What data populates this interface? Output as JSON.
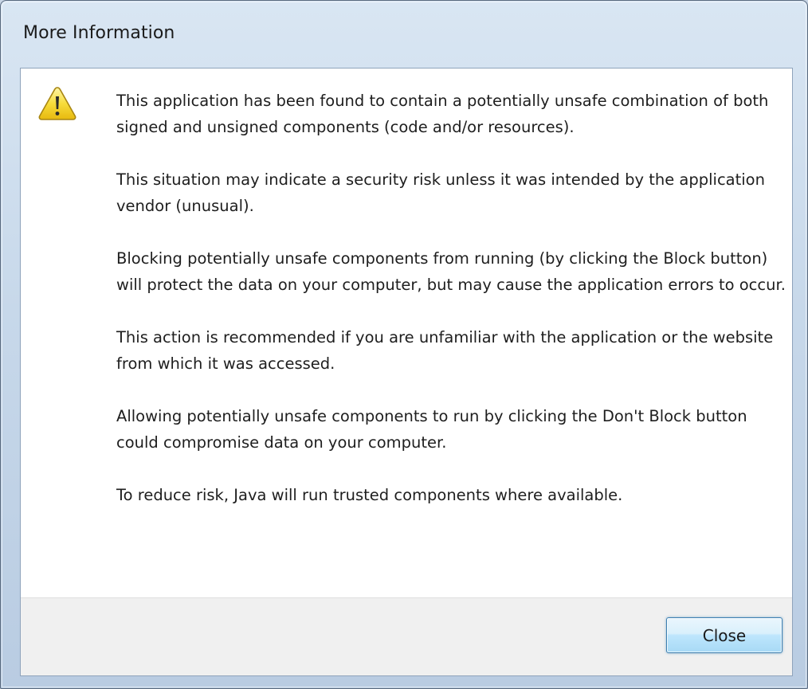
{
  "window": {
    "title": "More Information"
  },
  "icon": {
    "name": "warning-icon",
    "color": "#f5d31b"
  },
  "message": {
    "paragraphs": [
      "This application has been found to contain a potentially unsafe combination of both signed and unsigned components (code and/or resources).",
      "This situation may indicate a security risk unless it was intended by the application vendor (unusual).",
      "Blocking potentially unsafe components from running (by clicking the Block button) will protect the data on your computer, but may cause the application errors to occur.",
      "This action is recommended if you are unfamiliar with the application or the website from which it was accessed.",
      "Allowing potentially unsafe components to run by clicking the Don't Block button could compromise data on your computer.",
      "To reduce risk, Java will run trusted components where available."
    ]
  },
  "footer": {
    "close_label": "Close"
  },
  "colors": {
    "button_border": "#3c7fb1",
    "footer_bg": "#f0f0f0",
    "frame": "#c7d8ea"
  }
}
